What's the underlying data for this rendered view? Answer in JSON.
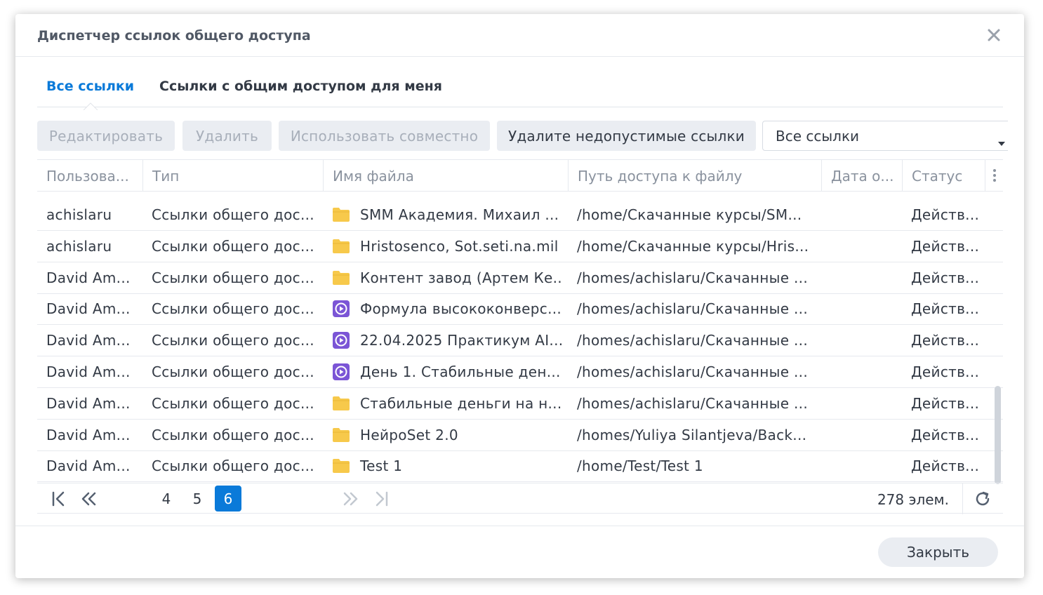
{
  "dialog": {
    "title": "Диспетчер ссылок общего доступа",
    "close_label": "Закрыть"
  },
  "tabs": [
    {
      "label": "Все ссылки",
      "active": true
    },
    {
      "label": "Ссылки с общим доступом для меня",
      "active": false
    }
  ],
  "toolbar": {
    "edit_label": "Редактировать",
    "delete_label": "Удалить",
    "share_label": "Использовать совместно",
    "remove_invalid_label": "Удалите недопустимые ссылки",
    "filter_value": "Все ссылки"
  },
  "table": {
    "columns": [
      "Пользова...",
      "Тип",
      "Имя файла",
      "Путь доступа к файлу",
      "Дата о...",
      "Статус"
    ],
    "rows": [
      {
        "user": "achislaru",
        "type": "Ссылки общего дос...",
        "icon": "folder-icon",
        "name": "SMM Академия. Михаил ...",
        "path": "/home/Скачанные курсы/SM...",
        "date": "",
        "status": "Действ..."
      },
      {
        "user": "achislaru",
        "type": "Ссылки общего дос...",
        "icon": "folder-icon",
        "name": "Hristosenco, Sot.seti.na.mil",
        "path": "/home/Скачанные курсы/Hris...",
        "date": "",
        "status": "Действ..."
      },
      {
        "user": "David Am...",
        "type": "Ссылки общего дос...",
        "icon": "folder-icon",
        "name": "Контент завод (Артем Ке...",
        "path": "/homes/achislaru/Скачанные ...",
        "date": "",
        "status": "Действ..."
      },
      {
        "user": "David Am...",
        "type": "Ссылки общего дос...",
        "icon": "video-icon",
        "name": "Формула высококонверс...",
        "path": "/homes/achislaru/Скачанные ...",
        "date": "",
        "status": "Действ..."
      },
      {
        "user": "David Am...",
        "type": "Ссылки общего дос...",
        "icon": "video-icon",
        "name": "22.04.2025 Практикум AI...",
        "path": "/homes/achislaru/Скачанные ...",
        "date": "",
        "status": "Действ..."
      },
      {
        "user": "David Am...",
        "type": "Ссылки общего дос...",
        "icon": "video-icon",
        "name": "День 1. Стабильные ден...",
        "path": "/homes/achislaru/Скачанные ...",
        "date": "",
        "status": "Действ..."
      },
      {
        "user": "David Am...",
        "type": "Ссылки общего дос...",
        "icon": "folder-icon",
        "name": "Стабильные деньги на н...",
        "path": "/homes/achislaru/Скачанные ...",
        "date": "",
        "status": "Действ..."
      },
      {
        "user": "David Am...",
        "type": "Ссылки общего дос...",
        "icon": "folder-icon",
        "name": "НейроSet 2.0",
        "path": "/homes/Yuliya Silantjeva/Back...",
        "date": "",
        "status": "Действ..."
      },
      {
        "user": "David Am...",
        "type": "Ссылки общего дос...",
        "icon": "folder-icon",
        "name": "Test 1",
        "path": "/home/Test/Test 1",
        "date": "",
        "status": "Действ..."
      }
    ]
  },
  "pager": {
    "pages": [
      "4",
      "5",
      "6"
    ],
    "current": "6",
    "count": "278 элем."
  },
  "colors": {
    "accent": "#0a7ad9",
    "folder": "#f7c94b",
    "video": "#7b55d6"
  }
}
